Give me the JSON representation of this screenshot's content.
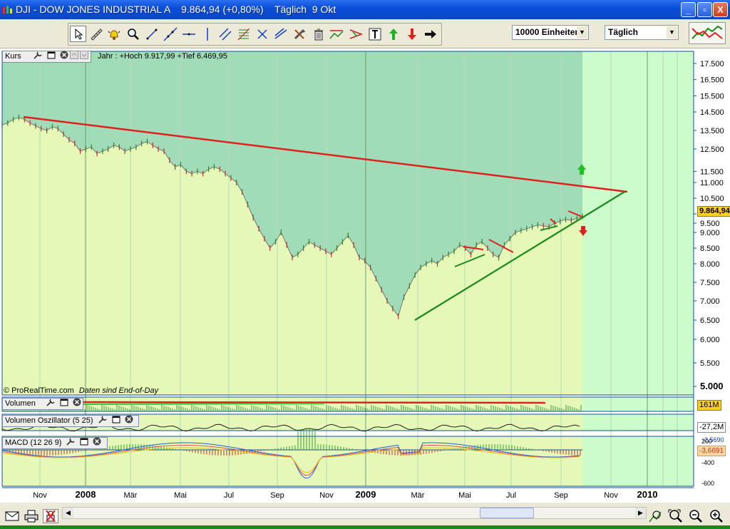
{
  "window": {
    "title": "DJI - DOW JONES INDUSTRIAL A    9.864,94 (+0,80%)    Täglich  9 Okt",
    "minimize": "_",
    "maximize": "▫",
    "close": "X"
  },
  "toolbar": {
    "tools": [
      "pointer-icon",
      "ruler-icon",
      "alarm-icon",
      "zoom-icon",
      "line-icon",
      "extended-line-icon",
      "horizontal-line-icon",
      "vertical-line-icon",
      "parallel-lines-icon",
      "fibonacci-icon",
      "cross-icon",
      "trendline-icon",
      "tools-icon",
      "trash-icon",
      "channel-icon",
      "triangle-icon",
      "text-icon",
      "buy-arrow-icon",
      "sell-arrow-icon",
      "forward-arrow-icon"
    ],
    "units_label": "10000 Einheiten",
    "period_label": "Täglich"
  },
  "price_panel": {
    "label": "Kurs",
    "info": "Jahr : +Hoch 9.917,99 +Tief 6.469,95",
    "copyright": "© ProRealTime.com",
    "eod_note": "Daten sind End-of-Day",
    "current_price": "9.864,94",
    "colors": {
      "above": "#a0dcb8",
      "below": "#e6f8b8",
      "future": "#ccfccc",
      "resistance": "#e02020",
      "support": "#1a8a1a"
    }
  },
  "volume_panel": {
    "label": "Volumen",
    "value": "161M"
  },
  "vo_panel": {
    "label": "Volumen Oszillator (5 25)",
    "value": "-27,2M"
  },
  "macd_panel": {
    "label": "MACD (12 26 9)",
    "value": "-3,6691",
    "value2": "-2,5690"
  },
  "chart_data": {
    "type": "line",
    "y_ticks": [
      "17.500",
      "16.500",
      "15.500",
      "14.500",
      "13.500",
      "12.500",
      "11.500",
      "11.000",
      "10.500",
      "10.000",
      "9.500",
      "9.000",
      "8.500",
      "8.000",
      "7.500",
      "7.000",
      "6.500",
      "6.000",
      "5.500",
      "5.000"
    ],
    "x_ticks": [
      "Nov",
      "2008",
      "Mär",
      "Mai",
      "Jul",
      "Sep",
      "Nov",
      "2009",
      "Mär",
      "Mai",
      "Jul",
      "Sep",
      "Nov",
      "2010"
    ],
    "macd_ticks": [
      "200",
      "-200",
      "-400",
      "-600"
    ],
    "year_high": 9917.99,
    "year_low": 6469.95,
    "last": 9864.94,
    "change_pct": 0.8,
    "series": [
      {
        "values": [
          13800,
          13900,
          14100,
          14200,
          14100,
          13900,
          13750,
          13600,
          13500,
          13700,
          13600,
          13300,
          13000,
          12800,
          12400,
          12500,
          12600,
          12300,
          12400,
          12500,
          12700,
          12600,
          12400,
          12500,
          12600,
          12800,
          12900,
          12700,
          12500,
          12400,
          12000,
          11700,
          11800,
          11500,
          11400,
          11500,
          11400,
          11600,
          11700,
          11600,
          11400,
          11200,
          11000,
          10700,
          10300,
          9800,
          9200,
          8800,
          8500,
          8700,
          9000,
          8600,
          8200,
          8300,
          8500,
          8700,
          8600,
          8500,
          8400,
          8300,
          8500,
          8700,
          8900,
          8600,
          8200,
          8100,
          7900,
          7600,
          7300,
          7000,
          6800,
          6600,
          7100,
          7400,
          7700,
          7900,
          8000,
          8100,
          8000,
          8200,
          8300,
          8400,
          8600,
          8500,
          8300,
          8600,
          8700,
          8500,
          8300,
          8200,
          8600,
          8800,
          9000,
          9100,
          9200,
          9300,
          9400,
          9350,
          9300,
          9500,
          9600,
          9700,
          9650,
          9750,
          9864.94
        ]
      }
    ]
  }
}
